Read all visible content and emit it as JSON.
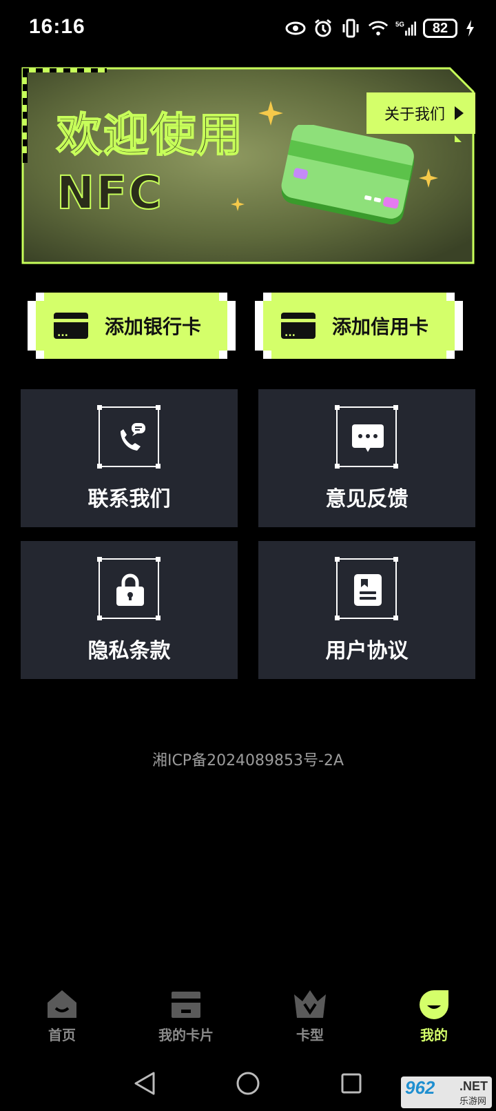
{
  "status_bar": {
    "time": "16:16",
    "battery": "82"
  },
  "banner": {
    "title_line1": "欢迎使用",
    "title_line2": "NFC",
    "about_label": "关于我们"
  },
  "actions": {
    "add_bank_card": "添加银行卡",
    "add_credit_card": "添加信用卡"
  },
  "tiles": [
    {
      "label": "联系我们",
      "icon": "phone-chat-icon"
    },
    {
      "label": "意见反馈",
      "icon": "message-icon"
    },
    {
      "label": "隐私条款",
      "icon": "lock-icon"
    },
    {
      "label": "用户协议",
      "icon": "document-icon"
    }
  ],
  "icp": "湘ICP备2024089853号-2A",
  "bottom_nav": [
    {
      "label": "首页",
      "icon": "home-icon",
      "active": false
    },
    {
      "label": "我的卡片",
      "icon": "card-icon",
      "active": false
    },
    {
      "label": "卡型",
      "icon": "crown-icon",
      "active": false
    },
    {
      "label": "我的",
      "icon": "profile-icon",
      "active": true
    }
  ],
  "watermark": {
    "brand": "962",
    "suffix": ".NET",
    "sub": "乐游网"
  },
  "colors": {
    "accent": "#d4ff6a",
    "tile_bg": "#242730",
    "background": "#000000"
  }
}
